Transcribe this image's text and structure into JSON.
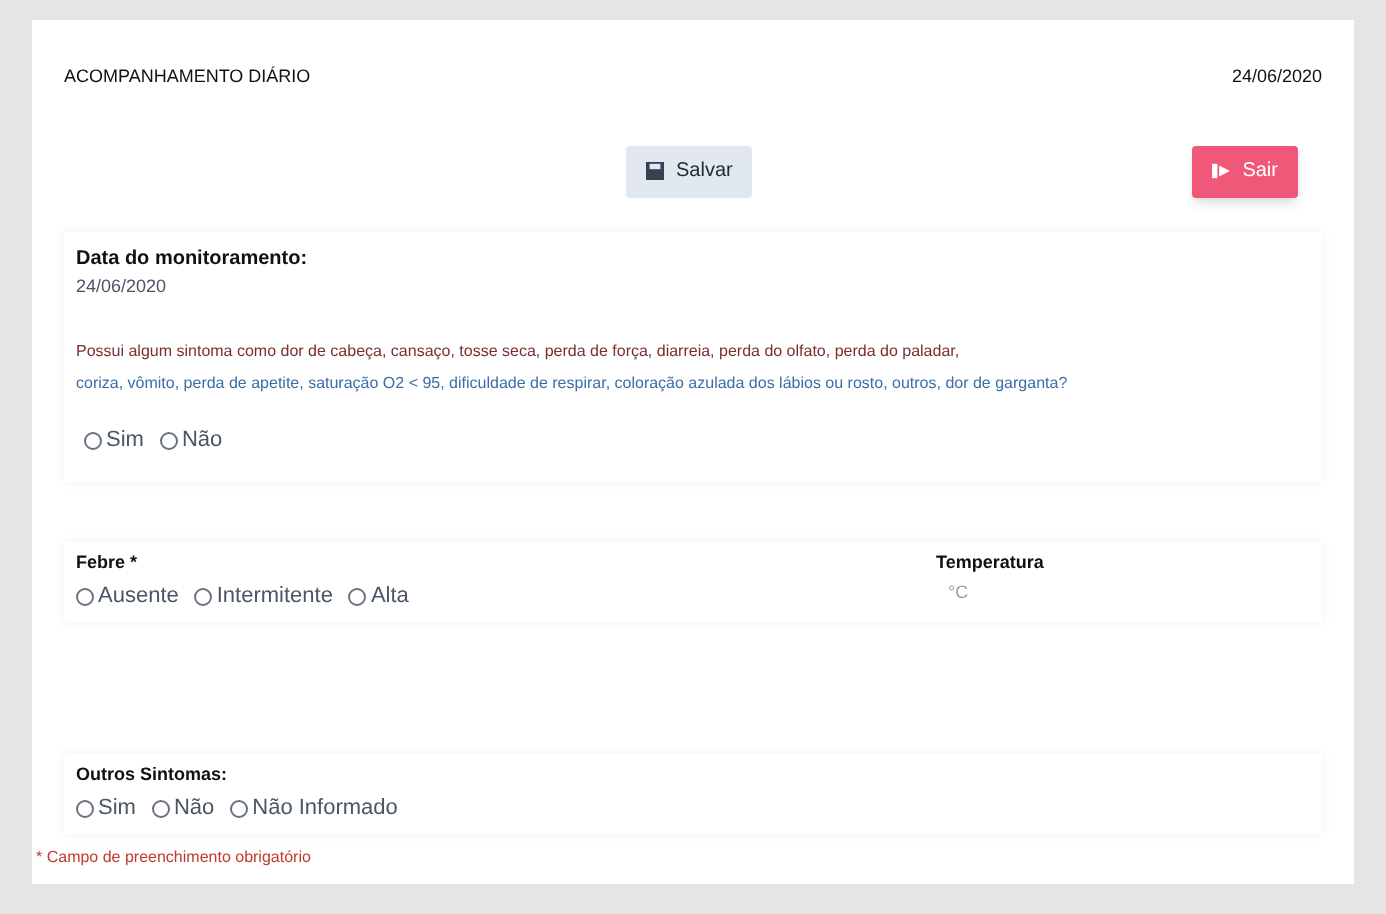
{
  "header": {
    "title": "ACOMPANHAMENTO DIÁRIO",
    "date": "24/06/2020"
  },
  "buttons": [
    {
      "kind": "save",
      "label": "Salvar"
    },
    {
      "kind": "exit",
      "label": "Sair"
    }
  ],
  "monitoring": {
    "label": "Data do monitoramento:",
    "date": "24/06/2020",
    "question_line_1": "Possui algum sintoma como dor de cabeça, cansaço, tosse seca, perda de força, diarreia, perda do olfato, perda do paladar,",
    "question_line_2": "coriza, vômito, perda de apetite, saturação O2 < 95, dificuldade de respirar, coloração azulada dos lábios ou rosto, outros, dor de garganta?",
    "options": [
      {
        "label": "Sim",
        "selected": false
      },
      {
        "label": "Não",
        "selected": false
      }
    ]
  },
  "fever": {
    "label": "Febre *",
    "options": [
      {
        "label": "Ausente",
        "selected": false
      },
      {
        "label": "Intermitente",
        "selected": false
      },
      {
        "label": "Alta",
        "selected": false
      }
    ]
  },
  "temperature": {
    "label": "Temperatura",
    "placeholder": "°C"
  },
  "other_symptoms": {
    "label": "Outros Sintomas:",
    "options": [
      {
        "label": "Sim",
        "selected": false
      },
      {
        "label": "Não",
        "selected": false
      },
      {
        "label": "Não Informado",
        "selected": false
      }
    ]
  },
  "footnote": "* Campo de preenchimento obrigatório"
}
